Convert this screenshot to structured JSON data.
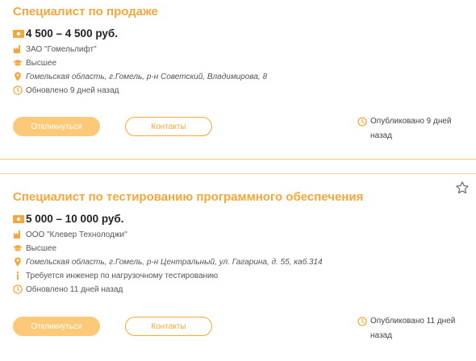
{
  "vacancies": [
    {
      "title": "Специалист по продаже",
      "salary": "4 500 – 4 500 руб.",
      "company": "ЗАО \"Гомельлифт\"",
      "education": "Высшее",
      "address": "Гомельская область, г.Гомель, р-н Советский, Владимирова, 8",
      "note": "",
      "updated": "Обновлено 9 дней назад",
      "respond_label": "Откликнуться",
      "contacts_label": "Контакты",
      "published": "Опубликовано 9 дней назад"
    },
    {
      "title": "Специалист по тестированию программного обеспечения",
      "salary": "5 000 – 10 000 руб.",
      "company": "ООО \"Клевер Технолоджи\"",
      "education": "Высшее",
      "address": "Гомельская область, г.Гомель, р-н Центральный, ул. Гагарина, д. 55, каб.314",
      "note": "Требуется инженер по нагрузочному тестированию",
      "updated": "Обновлено 11 дней назад",
      "respond_label": "Откликнуться",
      "contacts_label": "Контакты",
      "published": "Опубликовано 11 дней назад"
    }
  ],
  "icons": {
    "salary": "money-icon",
    "company": "factory-icon",
    "education": "graduation-cap-icon",
    "address": "location-pin-icon",
    "note": "info-icon",
    "updated": "clock-icon",
    "published": "clock-icon",
    "favorite": "star-icon"
  },
  "colors": {
    "accent": "#f5a73b",
    "button_fill": "#fbc978",
    "separator": "#f0c878"
  }
}
